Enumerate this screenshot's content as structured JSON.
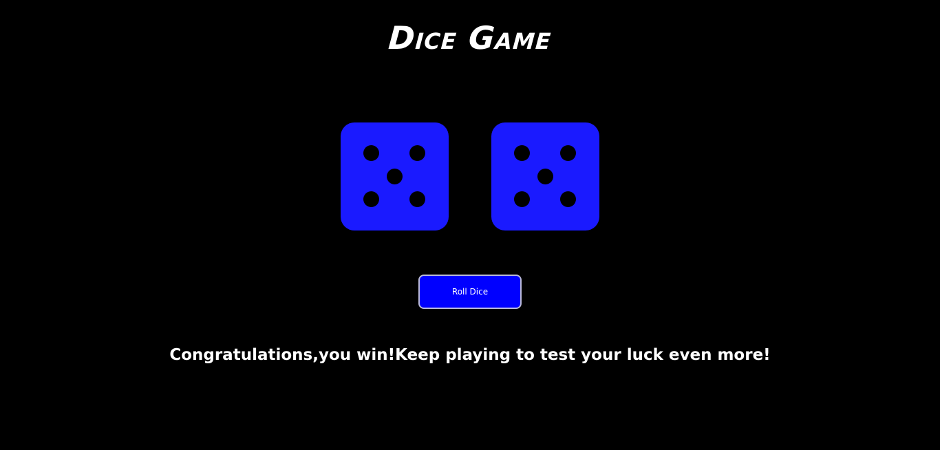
{
  "title": "Dice Game",
  "dice": [
    {
      "value": 5
    },
    {
      "value": 5
    }
  ],
  "roll_button": {
    "label": "Roll Dice"
  },
  "message": "Congratulations,you win!Keep playing to test your luck even more!",
  "colors": {
    "background": "#000000",
    "die": "#1a1aff",
    "pip": "#000000",
    "button": "#0000ff",
    "text": "#ffffff"
  }
}
